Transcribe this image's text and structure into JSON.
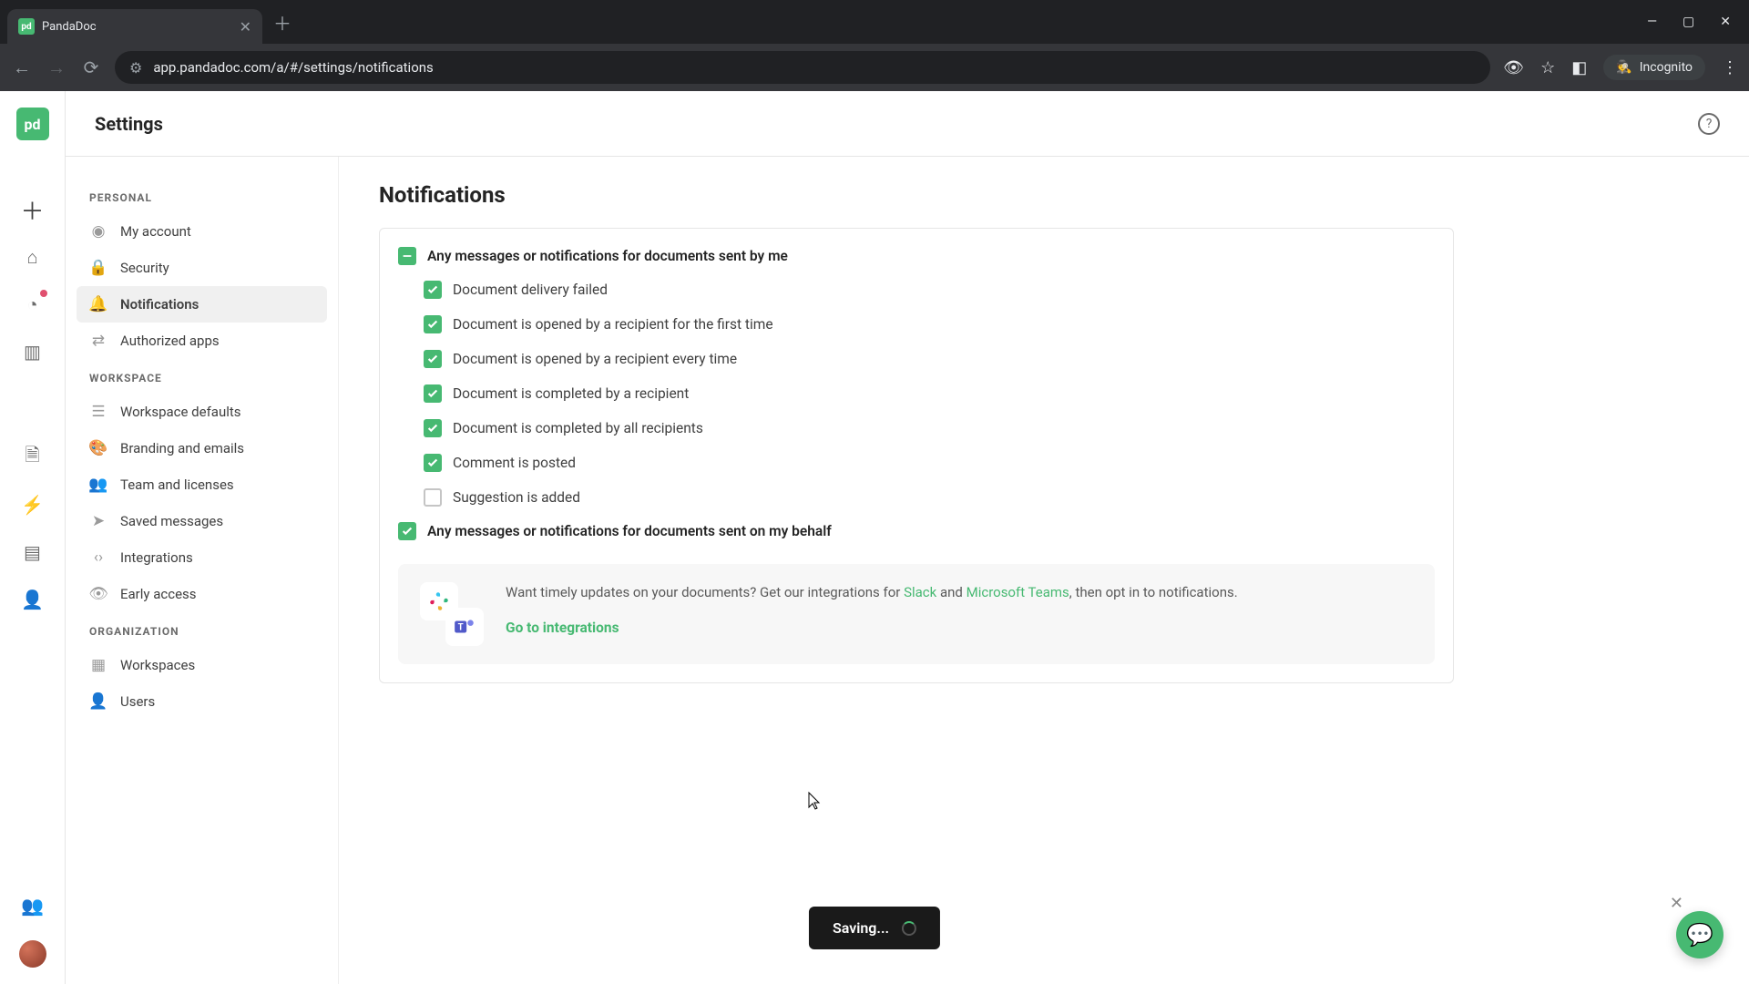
{
  "browser": {
    "tab_title": "PandaDoc",
    "url": "app.pandadoc.com/a/#/settings/notifications",
    "incognito_label": "Incognito"
  },
  "header": {
    "title": "Settings"
  },
  "sidebar": {
    "sections": {
      "personal": "PERSONAL",
      "workspace": "WORKSPACE",
      "organization": "ORGANIZATION"
    },
    "items": {
      "my_account": "My account",
      "security": "Security",
      "notifications": "Notifications",
      "authorized_apps": "Authorized apps",
      "workspace_defaults": "Workspace defaults",
      "branding": "Branding and emails",
      "team": "Team and licenses",
      "saved_messages": "Saved messages",
      "integrations": "Integrations",
      "early_access": "Early access",
      "workspaces": "Workspaces",
      "users": "Users"
    }
  },
  "panel": {
    "title": "Notifications",
    "parent_sent_by_me": "Any messages or notifications for documents sent by me",
    "children": {
      "delivery_failed": "Document delivery failed",
      "opened_first": "Document is opened by a recipient for the first time",
      "opened_every": "Document is opened by a recipient every time",
      "completed_recipient": "Document is completed by a recipient",
      "completed_all": "Document is completed by all recipients",
      "comment_posted": "Comment is posted",
      "suggestion_added": "Suggestion is added"
    },
    "parent_on_my_behalf": "Any messages or notifications for documents sent on my behalf",
    "promo": {
      "text_before": "Want timely updates on your documents? Get our integrations for ",
      "slack": "Slack",
      "text_mid": " and ",
      "teams": "Microsoft Teams",
      "text_after": ", then opt in to notifications.",
      "button": "Go to integrations"
    }
  },
  "toast": {
    "text": "Saving..."
  }
}
